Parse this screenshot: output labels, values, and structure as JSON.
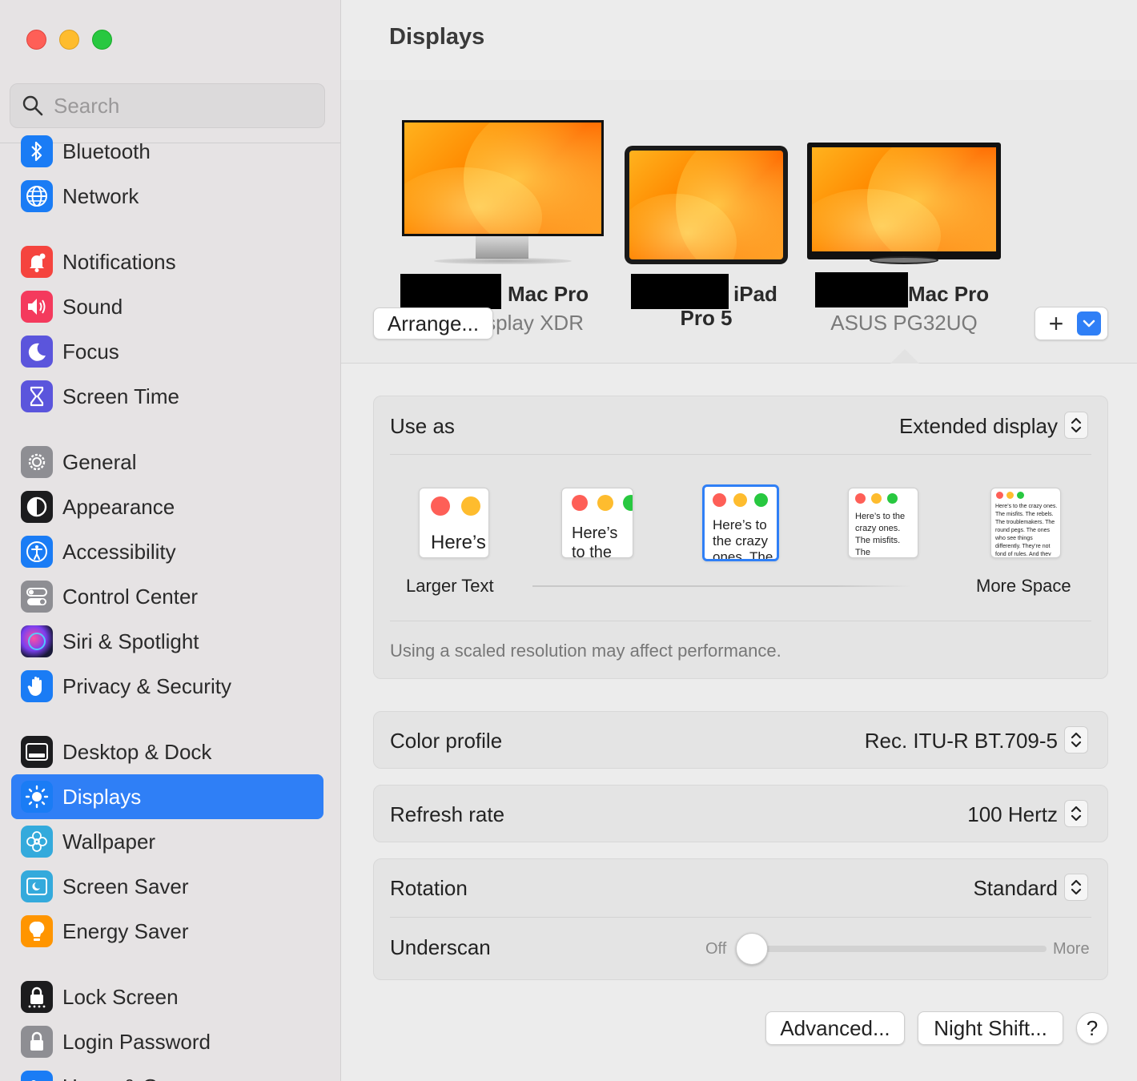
{
  "window": {
    "title": "Displays"
  },
  "search": {
    "placeholder": "Search"
  },
  "sidebar": {
    "items": [
      {
        "label": "Bluetooth",
        "icon": "bluetooth-icon",
        "color": "#1a7cf5"
      },
      {
        "label": "Network",
        "icon": "globe-icon",
        "color": "#1a7cf5"
      },
      {
        "label": "Notifications",
        "icon": "bell-icon",
        "color": "#f5443e"
      },
      {
        "label": "Sound",
        "icon": "speaker-icon",
        "color": "#f43a5d"
      },
      {
        "label": "Focus",
        "icon": "moon-icon",
        "color": "#5b55dc"
      },
      {
        "label": "Screen Time",
        "icon": "hourglass-icon",
        "color": "#5b55dc"
      },
      {
        "label": "General",
        "icon": "gear-icon",
        "color": "#8e8e93"
      },
      {
        "label": "Appearance",
        "icon": "appearance-icon",
        "color": "#1c1c1e"
      },
      {
        "label": "Accessibility",
        "icon": "accessibility-icon",
        "color": "#1a7cf5"
      },
      {
        "label": "Control Center",
        "icon": "toggles-icon",
        "color": "#8e8e93"
      },
      {
        "label": "Siri & Spotlight",
        "icon": "siri-icon",
        "color": "#6b3fa0"
      },
      {
        "label": "Privacy & Security",
        "icon": "hand-icon",
        "color": "#1a7cf5"
      },
      {
        "label": "Desktop & Dock",
        "icon": "dock-icon",
        "color": "#1c1c1e"
      },
      {
        "label": "Displays",
        "icon": "sun-icon",
        "color": "#1a7cf5",
        "selected": true
      },
      {
        "label": "Wallpaper",
        "icon": "flower-icon",
        "color": "#34aadc"
      },
      {
        "label": "Screen Saver",
        "icon": "screensaver-icon",
        "color": "#34aadc"
      },
      {
        "label": "Energy Saver",
        "icon": "bulb-icon",
        "color": "#ff9500"
      },
      {
        "label": "Lock Screen",
        "icon": "lock-dots-icon",
        "color": "#1c1c1e"
      },
      {
        "label": "Login Password",
        "icon": "lock-icon",
        "color": "#8e8e93"
      },
      {
        "label": "Users & Groups",
        "icon": "users-icon",
        "color": "#1a7cf5"
      }
    ]
  },
  "displays": [
    {
      "name": "Mac Pro",
      "subtitle": "Pro Display XDR"
    },
    {
      "name": "iPad",
      "subtitle": "Pro 5"
    },
    {
      "name": "Mac Pro",
      "subtitle": "ASUS PG32UQ",
      "selected": true
    }
  ],
  "buttons": {
    "arrange": "Arrange...",
    "add": "+",
    "advanced": "Advanced...",
    "night_shift": "Night Shift...",
    "help": "?"
  },
  "use_as": {
    "label": "Use as",
    "value": "Extended display"
  },
  "scaling": {
    "thumbnails": [
      {
        "text": "Here’s"
      },
      {
        "text": "Here’s to the crazy ones. The troublemakers."
      },
      {
        "text": "Here’s to the crazy ones. The troublemakers. The ones who see things differently.",
        "selected": true
      },
      {
        "text": "Here’s to the crazy ones. The misfits. The troublemakers. The round pegs. The ones who see things differently. They’re not fond of rules. And they have no respect"
      },
      {
        "text": "Here’s to the crazy ones. The misfits. The rebels. The troublemakers. The round pegs. The ones who see things differently. They’re not fond of rules. And they have no respect for the status quo. You can quote them, disagree with them. About the only thing you can’t do is ignore them. Because they change things."
      }
    ],
    "left_label": "Larger Text",
    "right_label": "More Space",
    "note": "Using a scaled resolution may affect performance."
  },
  "color_profile": {
    "label": "Color profile",
    "value": "Rec. ITU-R BT.709-5"
  },
  "refresh_rate": {
    "label": "Refresh rate",
    "value": "100 Hertz"
  },
  "rotation": {
    "label": "Rotation",
    "value": "Standard"
  },
  "underscan": {
    "label": "Underscan",
    "min_label": "Off",
    "max_label": "More",
    "value": 0
  }
}
